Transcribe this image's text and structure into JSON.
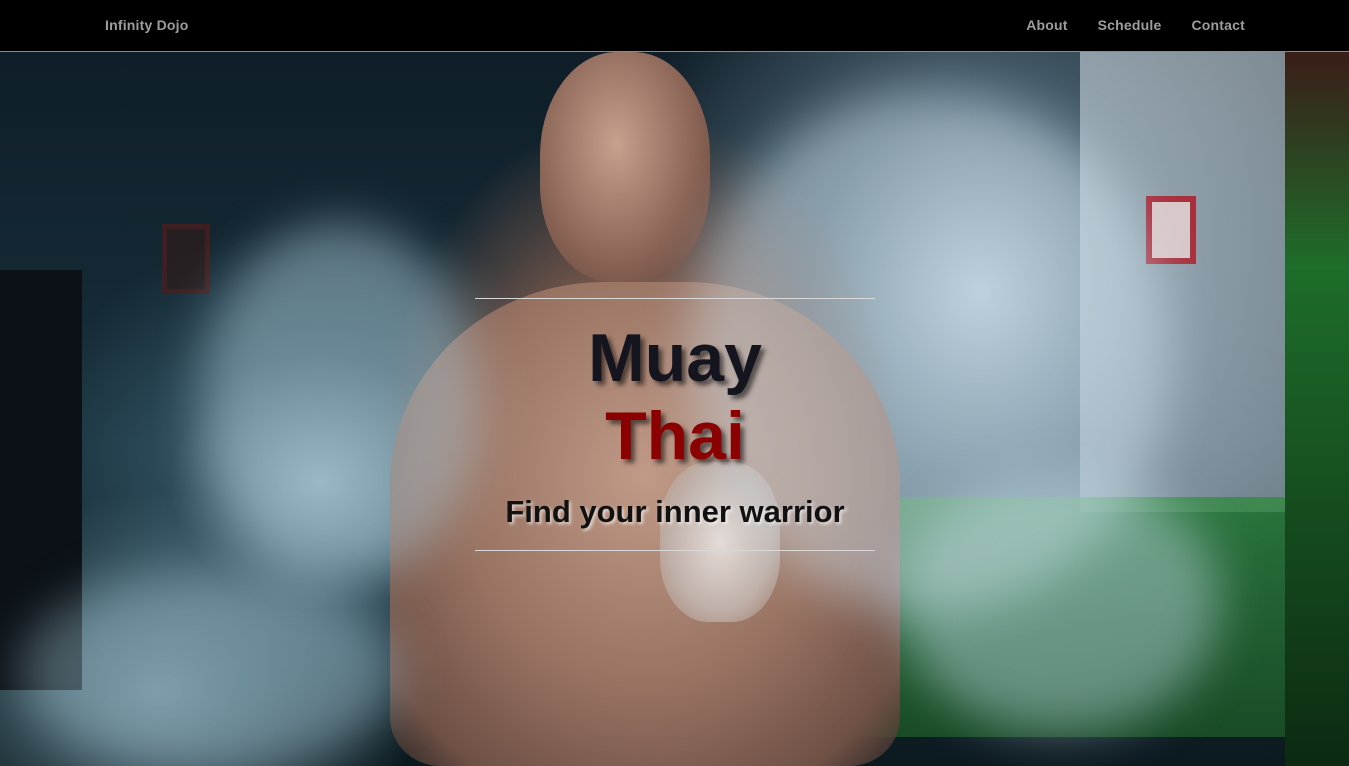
{
  "navbar": {
    "brand": "Infinity Dojo",
    "links": [
      {
        "label": "About"
      },
      {
        "label": "Schedule"
      },
      {
        "label": "Contact"
      }
    ]
  },
  "hero": {
    "title_line_1": "Muay",
    "title_line_2": "Thai",
    "subtitle": "Find your inner warrior"
  },
  "colors": {
    "nav_background": "#000000",
    "nav_text": "#9d9d9d",
    "title_dark": "#151520",
    "title_accent": "#8b0000"
  }
}
